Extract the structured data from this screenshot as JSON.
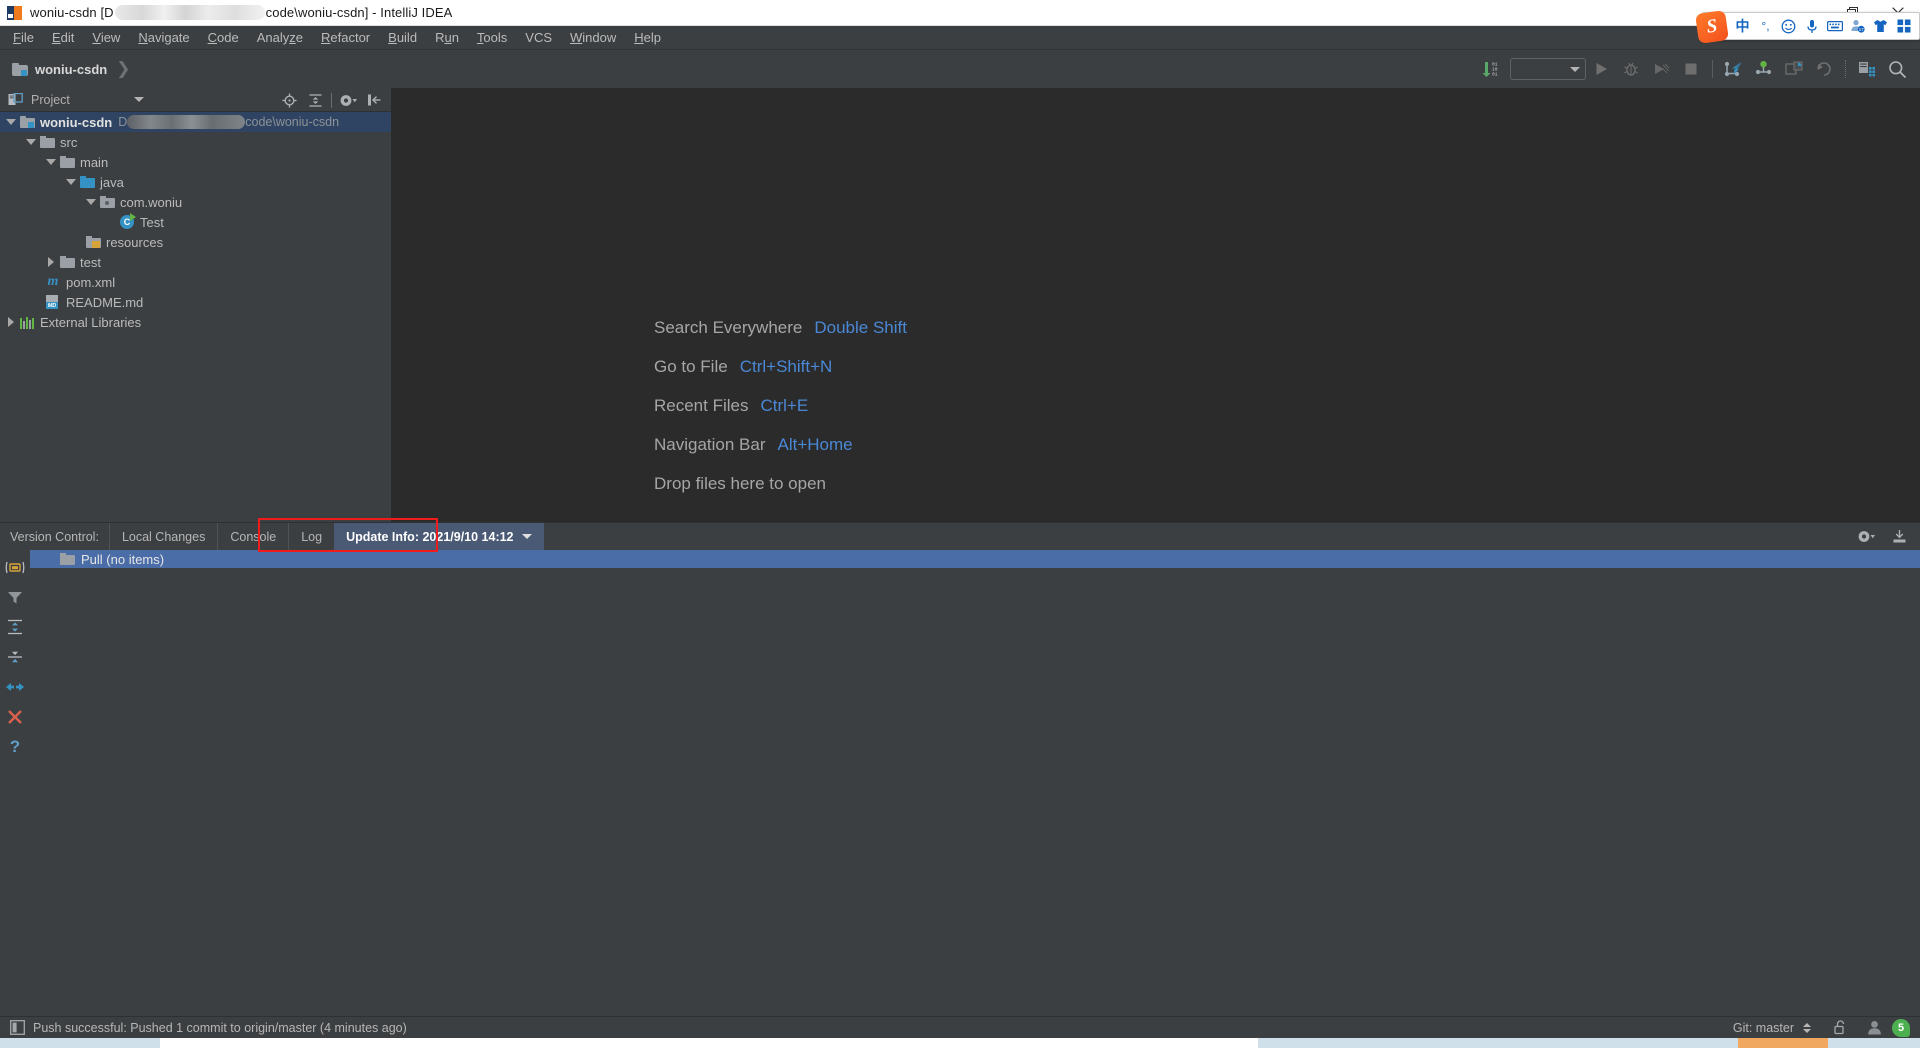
{
  "window": {
    "title_prefix": "woniu-csdn [D",
    "title_suffix": "code\\woniu-csdn] - IntelliJ IDEA",
    "app_icon": "intellij-idea-icon",
    "minimize_label": "Minimize",
    "restore_label": "Restore",
    "close_label": "Close"
  },
  "ime": {
    "logo": "sogou-logo",
    "items": [
      "中",
      "°,",
      "☺",
      "🎤",
      "⌨",
      "👤",
      "👕",
      "▦"
    ]
  },
  "menubar": {
    "items": [
      {
        "label": "File",
        "mnemonic": "F"
      },
      {
        "label": "Edit",
        "mnemonic": "E"
      },
      {
        "label": "View",
        "mnemonic": "V"
      },
      {
        "label": "Navigate",
        "mnemonic": "N"
      },
      {
        "label": "Code",
        "mnemonic": "C"
      },
      {
        "label": "Analyze",
        "mnemonic": "z"
      },
      {
        "label": "Refactor",
        "mnemonic": "R"
      },
      {
        "label": "Build",
        "mnemonic": "B"
      },
      {
        "label": "Run",
        "mnemonic": "u"
      },
      {
        "label": "Tools",
        "mnemonic": "T"
      },
      {
        "label": "VCS",
        "mnemonic": ""
      },
      {
        "label": "Window",
        "mnemonic": "W"
      },
      {
        "label": "Help",
        "mnemonic": "H"
      }
    ]
  },
  "navbar": {
    "crumb": "woniu-csdn",
    "run_config_placeholder": "",
    "toolbar_icons": [
      "download-update-icon",
      "run-config-dropdown",
      "run-icon",
      "debug-icon",
      "coverage-icon",
      "stop-icon",
      "vcs-update-project-icon",
      "vcs-commit-icon",
      "vcs-push-icon",
      "vcs-rollback-icon",
      "search-structure-icon",
      "search-everywhere-icon"
    ]
  },
  "project_panel": {
    "header_label": "Project",
    "header_icon": "project-view-icon",
    "tools": [
      "locate-icon",
      "collapse-all-icon",
      "settings-gear-icon",
      "hide-panel-icon"
    ],
    "tree": [
      {
        "label": "woniu-csdn",
        "icon": "module-folder-icon",
        "indent": 0,
        "arrow": "down",
        "selected": true,
        "bold": true,
        "path_prefix": "D",
        "path_suffix": "code\\woniu-csdn"
      },
      {
        "label": "src",
        "icon": "folder-grey-icon",
        "indent": 1,
        "arrow": "down",
        "selected": false
      },
      {
        "label": "main",
        "icon": "folder-grey-icon",
        "indent": 2,
        "arrow": "down",
        "selected": false
      },
      {
        "label": "java",
        "icon": "source-root-folder-icon",
        "indent": 3,
        "arrow": "down",
        "selected": false
      },
      {
        "label": "com.woniu",
        "icon": "package-folder-icon",
        "indent": 4,
        "arrow": "down",
        "selected": false
      },
      {
        "label": "Test",
        "icon": "java-class-runnable-icon",
        "indent": 5,
        "arrow": "none",
        "selected": false
      },
      {
        "label": "resources",
        "icon": "resources-folder-icon",
        "indent": 3,
        "arrow": "none",
        "selected": false
      },
      {
        "label": "test",
        "icon": "folder-grey-icon",
        "indent": 2,
        "arrow": "right",
        "selected": false
      },
      {
        "label": "pom.xml",
        "icon": "maven-pom-icon",
        "indent": 2,
        "arrow": "none",
        "selected": false
      },
      {
        "label": "README.md",
        "icon": "markdown-file-icon",
        "indent": 2,
        "arrow": "none",
        "selected": false
      },
      {
        "label": "External Libraries",
        "icon": "external-libraries-icon",
        "indent": 0,
        "arrow": "right",
        "selected": false
      }
    ]
  },
  "editor": {
    "shortcuts": [
      {
        "action": "Search Everywhere",
        "key": "Double Shift"
      },
      {
        "action": "Go to File",
        "key": "Ctrl+Shift+N"
      },
      {
        "action": "Recent Files",
        "key": "Ctrl+E"
      },
      {
        "action": "Navigation Bar",
        "key": "Alt+Home"
      },
      {
        "action": "Drop files here to open",
        "key": ""
      }
    ]
  },
  "version_control": {
    "title": "Version Control:",
    "tabs": [
      {
        "label": "Local Changes",
        "active": false
      },
      {
        "label": "Console",
        "active": false
      },
      {
        "label": "Log",
        "active": false
      },
      {
        "label": "Update Info: 2021/9/10 14:12",
        "active": true,
        "has_dropdown": true
      }
    ],
    "right_tools": [
      "settings-gear-icon",
      "hide-panel-icon"
    ],
    "sidebar_icons": [
      "group-by-directory-icon",
      "filter-icon",
      "expand-all-icon",
      "collapse-all-icon",
      "diff-icon",
      "close-icon",
      "help-icon"
    ],
    "tree_row": {
      "label": "Pull (no items)",
      "icon": "folder-grey-icon"
    },
    "highlight_color": "#f01c1c"
  },
  "statusbar": {
    "icon": "toggle-toolwindows-icon",
    "message": "Push successful: Pushed 1 commit to origin/master (4 minutes ago)",
    "git_branch": "Git: master",
    "lock_icon": "unlocked-icon",
    "user_icon": "user-icon",
    "notification_count": "5"
  },
  "theme": {
    "bg_chrome": "#3c3f41",
    "bg_editor": "#2b2b2b",
    "accent_blue": "#4a88d6",
    "selection_blue": "#2f4463",
    "tab_active": "#4a5a75",
    "row_selected": "#4a6da7",
    "text_primary": "#bbbbbb",
    "green": "#62b543"
  }
}
